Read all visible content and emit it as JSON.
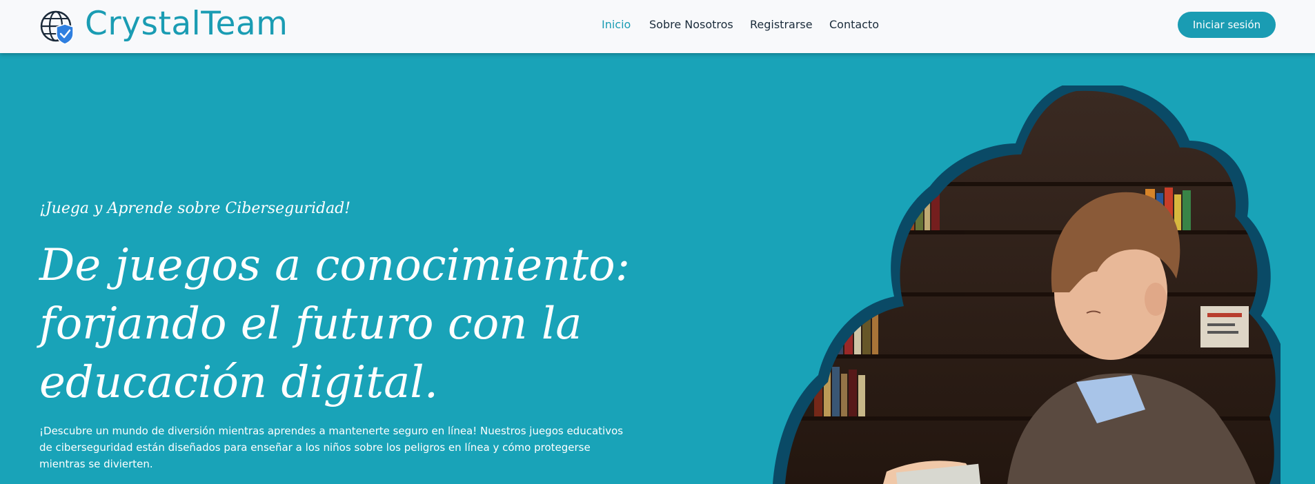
{
  "header": {
    "brand": "CrystalTeam",
    "logo_icon": "globe-shield-icon",
    "nav": [
      {
        "label": "Inicio",
        "active": true
      },
      {
        "label": "Sobre Nosotros",
        "active": false
      },
      {
        "label": "Registrarse",
        "active": false
      },
      {
        "label": "Contacto",
        "active": false
      }
    ],
    "login_label": "Iniciar sesión"
  },
  "hero": {
    "eyebrow": "¡Juega y Aprende sobre Ciberseguridad!",
    "headline": "De juegos a conocimiento: forjando el futuro con la educación digital.",
    "description": "¡Descubre un mundo de diversión mientras aprendes a mantenerte seguro en línea! Nuestros juegos educativos de ciberseguridad están diseñados para enseñar a los niños sobre los peligros en línea y cómo protegerse mientras se divierten.",
    "image": "boy-reading-in-library-photo"
  },
  "colors": {
    "accent": "#1a9cb3",
    "hero_bg": "#19a3b8",
    "cloud_border": "#0a4a66",
    "nav_bg": "#f8f9fb",
    "nav_text": "#1a2b3a"
  }
}
